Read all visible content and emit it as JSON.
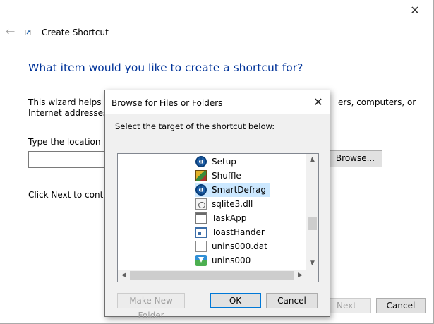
{
  "wizard": {
    "title": "Create Shortcut",
    "close_glyph": "✕",
    "back_glyph": "←",
    "heading": "What item would you like to create a shortcut for?",
    "description_visible_start": "This wizard helps you",
    "description_visible_end": "ers, computers, or",
    "description_line2": "Internet addresses.",
    "location_label": "Type the location of t",
    "location_value": "",
    "browse_label": "Browse...",
    "next_instruction": "Click Next to continu",
    "next_label": "Next",
    "cancel_label": "Cancel"
  },
  "browse_dialog": {
    "title": "Browse for Files or Folders",
    "close_glyph": "✕",
    "prompt": "Select the target of the shortcut below:",
    "items": [
      {
        "label": "Setup",
        "icon": "gear-icon",
        "selected": false
      },
      {
        "label": "Shuffle",
        "icon": "cards-icon",
        "selected": false
      },
      {
        "label": "SmartDefrag",
        "icon": "gear-icon",
        "selected": true
      },
      {
        "label": "sqlite3.dll",
        "icon": "dll-file-icon",
        "selected": false
      },
      {
        "label": "TaskApp",
        "icon": "app-window-icon",
        "selected": false
      },
      {
        "label": "ToastHander",
        "icon": "toast-app-icon",
        "selected": false
      },
      {
        "label": "unins000.dat",
        "icon": "blank-file-icon",
        "selected": false
      },
      {
        "label": "unins000",
        "icon": "uninstaller-icon",
        "selected": false
      }
    ],
    "scroll_up_glyph": "▲",
    "scroll_down_glyph": "▼",
    "scroll_left_glyph": "◀",
    "scroll_right_glyph": "▶",
    "make_new_folder_label": "Make New Folder",
    "ok_label": "OK",
    "cancel_label": "Cancel"
  },
  "colors": {
    "heading": "#003399",
    "selection": "#cce8ff",
    "default_button_border": "#0078d7"
  }
}
